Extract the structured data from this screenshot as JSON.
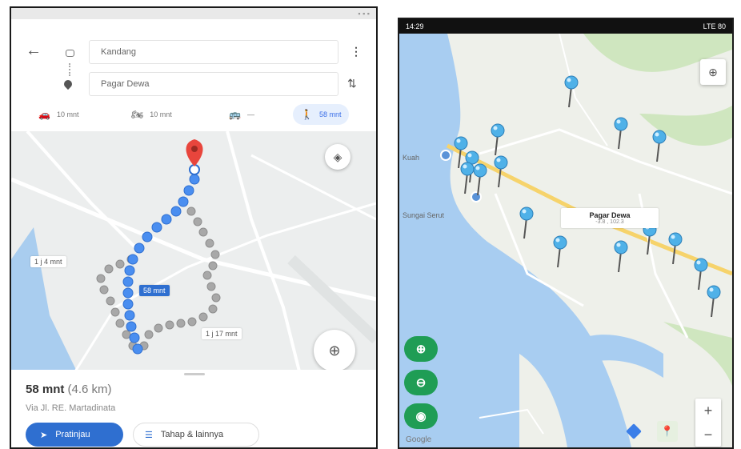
{
  "left_screen": {
    "status_time": "",
    "origin_value": "Kandang",
    "destination_value": "Pagar Dewa",
    "modes": [
      {
        "name": "car",
        "icon": "car-icon",
        "time": "10 mnt",
        "active": false
      },
      {
        "name": "motorcycle",
        "icon": "motorcycle-icon",
        "time": "10 mnt",
        "active": false
      },
      {
        "name": "transit",
        "icon": "bus-icon",
        "time": "—",
        "active": false
      },
      {
        "name": "walk",
        "icon": "walking-icon",
        "time": "58 mnt",
        "active": true
      }
    ],
    "map": {
      "route_labels": {
        "main": "58 mnt",
        "alt1": "1 j 4 mnt",
        "alt2": "1 j 17 mnt"
      }
    },
    "summary": {
      "duration": "58 mnt",
      "distance": "(4.6 km)",
      "via": "Via Jl. RE. Martadinata"
    },
    "buttons": {
      "preview": "Pratinjau",
      "steps": "Tahap & lainnya"
    },
    "colors": {
      "route_blue": "#4a8ef0",
      "route_gray": "#a8a8a8",
      "accent": "#3a6ee8",
      "pin_red": "#e8453c"
    }
  },
  "right_screen": {
    "status_time": "14:29",
    "status_right": "LTE 80",
    "map": {
      "popup_title": "Pagar Dewa",
      "popup_subtitle": "-3.8 , 102.3",
      "side_labels": [
        "Kuah",
        "Sungai Serut"
      ]
    },
    "zoom_plus": "+",
    "zoom_minus": "−",
    "google_logo": "Google",
    "colors": {
      "sea": "#a8cdf1",
      "land": "#eef0ea",
      "green_btn": "#1f9d55",
      "pin": "#4fb1e8"
    }
  }
}
